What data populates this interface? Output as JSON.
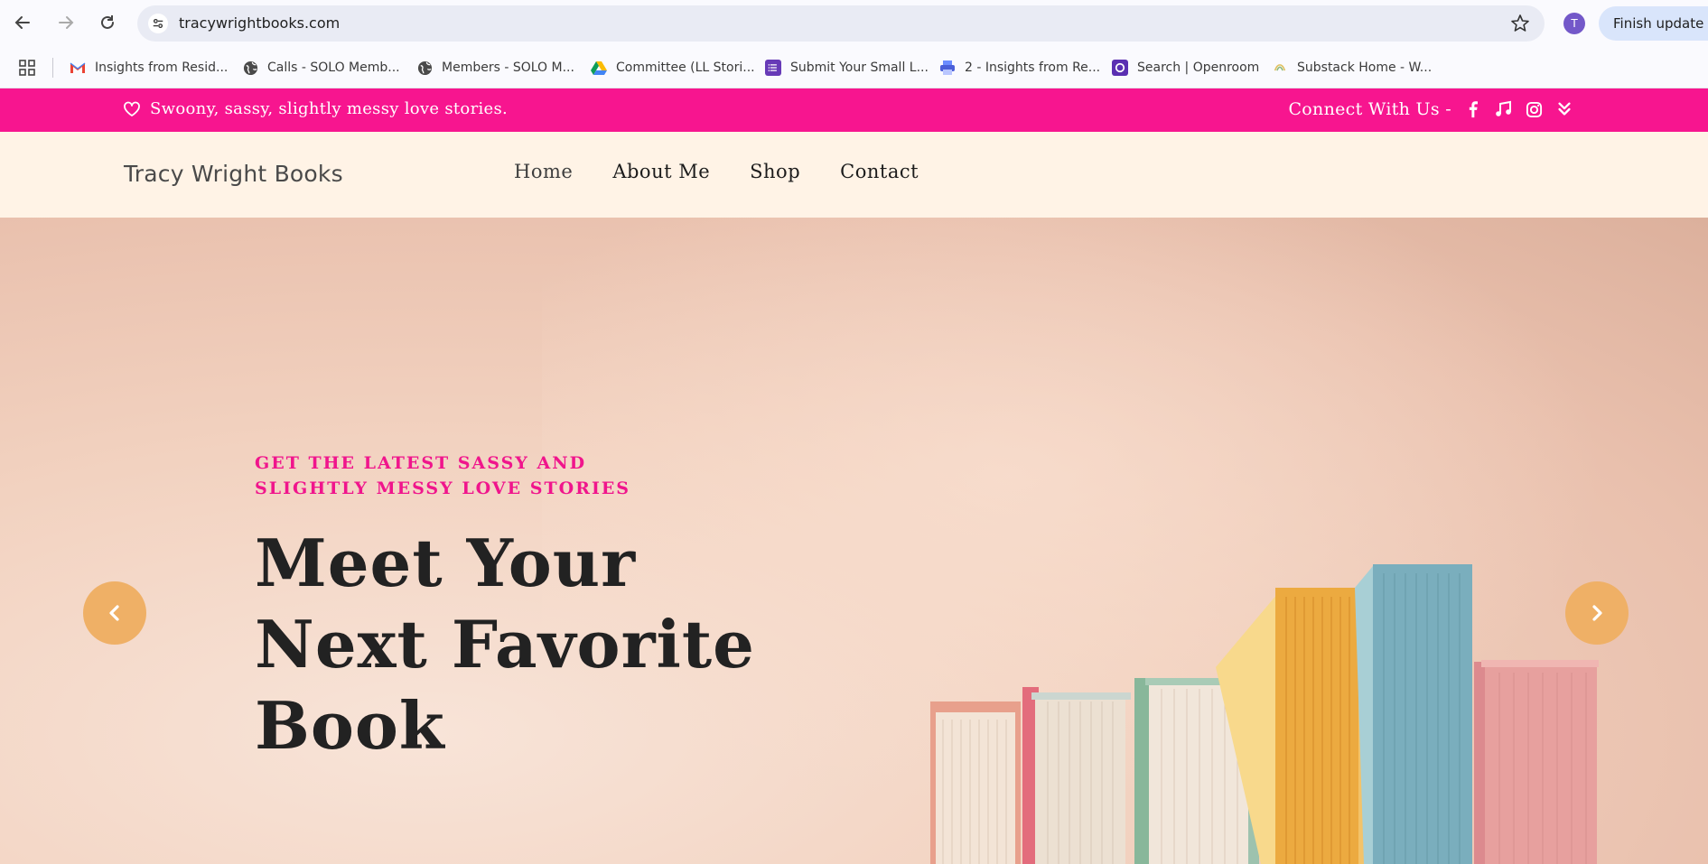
{
  "browser": {
    "url": "tracywrightbooks.com",
    "avatar_letter": "T",
    "finish_update_label": "Finish update",
    "bookmarks": [
      {
        "label": "Insights from Resid...",
        "icon": "gmail-icon"
      },
      {
        "label": "Calls - SOLO Memb...",
        "icon": "globe-icon"
      },
      {
        "label": "Members - SOLO M...",
        "icon": "globe-icon"
      },
      {
        "label": "Committee (LL Stori...",
        "icon": "google-drive-icon"
      },
      {
        "label": "Submit Your Small L...",
        "icon": "google-forms-icon"
      },
      {
        "label": "2 - Insights from Re...",
        "icon": "printer-icon"
      },
      {
        "label": "Search | Openroom",
        "icon": "openroom-icon"
      },
      {
        "label": "Substack Home - W...",
        "icon": "substack-icon"
      }
    ]
  },
  "site": {
    "topbar": {
      "tagline": "Swoony, sassy, slightly messy love stories.",
      "connect_label": "Connect With Us -",
      "social_icons": [
        "facebook-icon",
        "music-icon",
        "instagram-icon",
        "chevrons-down-icon"
      ]
    },
    "brand": "Tracy Wright Books",
    "nav": [
      "Home",
      "About Me",
      "Shop",
      "Contact"
    ],
    "hero": {
      "subtitle_line1": "GET THE LATEST SASSY AND",
      "subtitle_line2": "SLIGHTLY MESSY LOVE STORIES",
      "title_line1": "Meet Your",
      "title_line2": "Next Favorite",
      "title_line3": "Book"
    },
    "colors": {
      "topbar": "#f7158f",
      "header_bg": "#fff3e6",
      "accent_text": "#f0158c",
      "arrow_bg": "#efb066"
    }
  }
}
